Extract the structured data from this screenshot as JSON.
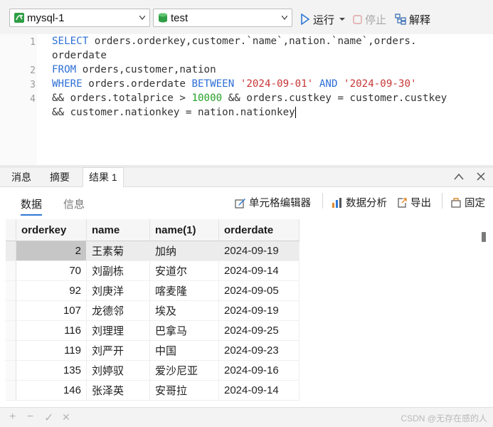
{
  "toolbar": {
    "connection": "mysql-1",
    "database": "test",
    "run_label": "运行",
    "stop_label": "停止",
    "explain_label": "解释"
  },
  "editor": {
    "line_numbers": [
      "1",
      "2",
      "3",
      "4"
    ],
    "lines": [
      {
        "kind": "select",
        "kw": "SELECT",
        "text": " orders.orderkey,customer.`name`,nation.`name`,orders."
      },
      {
        "kind": "wrap",
        "text": "orderdate"
      },
      {
        "kind": "from",
        "kw": "FROM",
        "text": " orders,customer,nation"
      },
      {
        "kind": "where",
        "kw1": "WHERE",
        "t1": " orders.orderdate ",
        "kw2": "BETWEEN",
        "t2": " ",
        "s1": "'2024-09-01'",
        "t3": " ",
        "kw3": "AND",
        "t4": " ",
        "s2": "'2024-09-30'"
      },
      {
        "kind": "cond",
        "t1": "&& orders.totalprice > ",
        "n1": "10000",
        "t2": " && orders.custkey = customer.custkey"
      },
      {
        "kind": "plain",
        "text": "&& customer.nationkey = nation.nationkey"
      }
    ]
  },
  "tabs": [
    "消息",
    "摘要",
    "结果 1"
  ],
  "subtabs": [
    "数据",
    "信息"
  ],
  "actions": {
    "cell_editor": "单元格编辑器",
    "data_analysis": "数据分析",
    "export": "导出",
    "pin": "固定"
  },
  "table": {
    "columns": [
      "orderkey",
      "name",
      "name(1)",
      "orderdate"
    ],
    "rows": [
      [
        "2",
        "王素菊",
        "加纳",
        "2024-09-19"
      ],
      [
        "70",
        "刘副栋",
        "安道尔",
        "2024-09-14"
      ],
      [
        "92",
        "刘庚洋",
        "喀麦隆",
        "2024-09-05"
      ],
      [
        "107",
        "龙德邻",
        "埃及",
        "2024-09-19"
      ],
      [
        "116",
        "刘理理",
        "巴拿马",
        "2024-09-25"
      ],
      [
        "119",
        "刘严开",
        "中国",
        "2024-09-23"
      ],
      [
        "135",
        "刘婷驭",
        "爱沙尼亚",
        "2024-09-16"
      ],
      [
        "146",
        "张泽英",
        "安哥拉",
        "2024-09-14"
      ]
    ]
  },
  "bottom": {
    "plus": "+",
    "minus": "−",
    "check": "✓",
    "cross": "✕",
    "watermark": "CSDN @无存在感的人"
  },
  "colors": {
    "keyword": "#2d6fd6",
    "string": "#c73636",
    "number": "#27a227",
    "accent": "#2d78d4"
  }
}
